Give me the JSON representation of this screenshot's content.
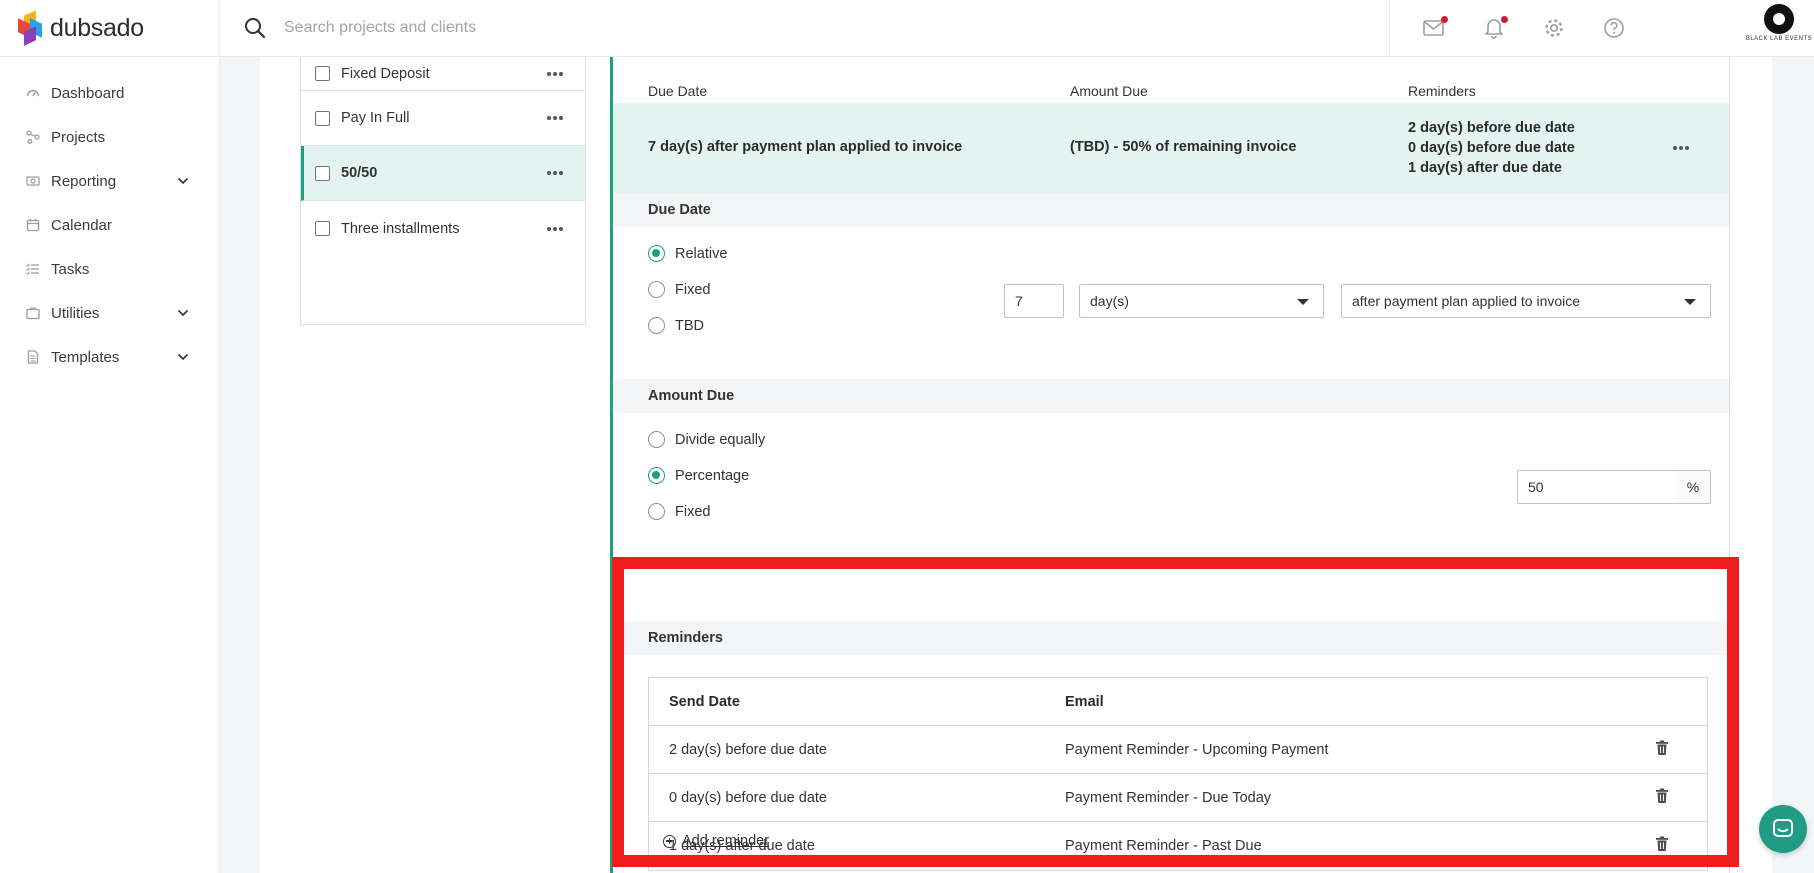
{
  "brand": {
    "name": "dubsado"
  },
  "search": {
    "placeholder": "Search projects and clients"
  },
  "header_icons": [
    "mail-icon",
    "bell-icon",
    "gear-icon",
    "help-icon"
  ],
  "account": {
    "label": "BLACK LAB EVENTS"
  },
  "sidebar": {
    "items": [
      {
        "label": "Dashboard",
        "icon": "dashboard-icon"
      },
      {
        "label": "Projects",
        "icon": "projects-icon"
      },
      {
        "label": "Reporting",
        "icon": "reporting-icon",
        "expandable": true
      },
      {
        "label": "Calendar",
        "icon": "calendar-icon"
      },
      {
        "label": "Tasks",
        "icon": "tasks-icon"
      },
      {
        "label": "Utilities",
        "icon": "utilities-icon",
        "expandable": true
      },
      {
        "label": "Templates",
        "icon": "templates-icon",
        "expandable": true
      }
    ]
  },
  "plans": {
    "items": [
      {
        "label": "Fixed Deposit"
      },
      {
        "label": "Pay In Full"
      },
      {
        "label": "50/50",
        "selected": true
      },
      {
        "label": "Three installments"
      }
    ]
  },
  "installment": {
    "columns": {
      "due_date": "Due Date",
      "amount_due": "Amount Due",
      "reminders": "Reminders"
    },
    "summary": {
      "due_date": "7 day(s) after payment plan applied to invoice",
      "amount_due": "(TBD) - 50% of remaining invoice",
      "reminders": [
        "2 day(s) before due date",
        "0 day(s) before due date",
        "1 day(s) after due date"
      ]
    },
    "due_date_section": {
      "title": "Due Date",
      "options": [
        "Relative",
        "Fixed",
        "TBD"
      ],
      "selected": "Relative",
      "offset_value": "7",
      "unit": "day(s)",
      "relation": "after payment plan applied to invoice"
    },
    "amount_section": {
      "title": "Amount Due",
      "options": [
        "Divide equally",
        "Percentage",
        "Fixed"
      ],
      "selected": "Percentage",
      "percent_value": "50",
      "percent_symbol": "%"
    },
    "reminders_section": {
      "title": "Reminders",
      "headers": {
        "send_date": "Send Date",
        "email": "Email"
      },
      "rows": [
        {
          "send_date": "2 day(s) before due date",
          "email": "Payment Reminder - Upcoming Payment"
        },
        {
          "send_date": "0 day(s) before due date",
          "email": "Payment Reminder - Due Today"
        },
        {
          "send_date": "1 day(s) after due date",
          "email": "Payment Reminder - Past Due"
        }
      ],
      "add_label": "Add reminder"
    }
  },
  "colors": {
    "accent": "#20a083",
    "selected_bg": "#e3f4f1",
    "highlight": "#f11d1d",
    "notify": "#d0192f"
  }
}
